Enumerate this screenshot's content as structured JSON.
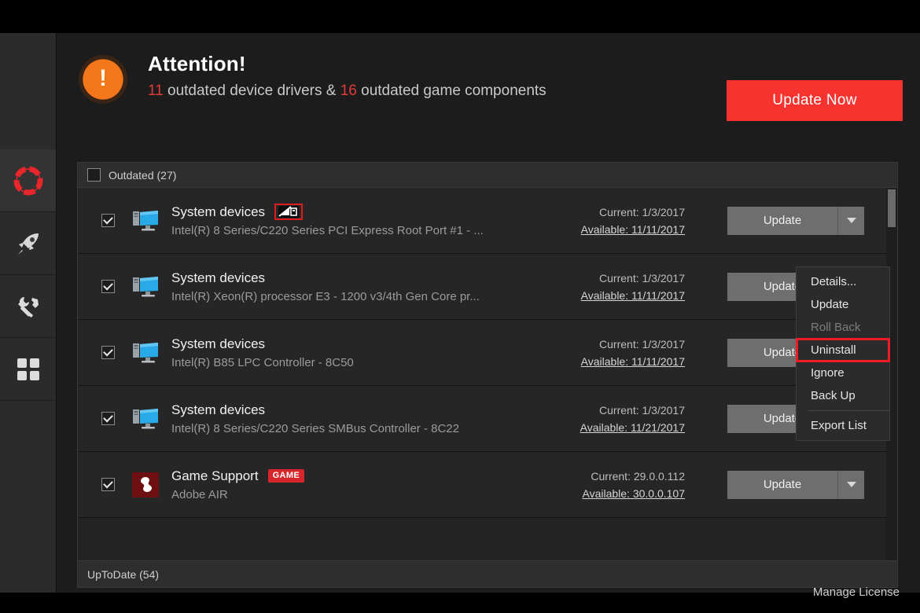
{
  "sidebar": {
    "items": [
      {
        "name": "life-ring-icon",
        "label": "Driver Updates",
        "active": true
      },
      {
        "name": "rocket-icon",
        "label": "Game Boost",
        "active": false
      },
      {
        "name": "tools-icon",
        "label": "Tools",
        "active": false
      },
      {
        "name": "grid-icon",
        "label": "Apps",
        "active": false
      }
    ]
  },
  "header": {
    "icon": "exclamation-icon",
    "title": "Attention!",
    "drivers_count": "11",
    "drivers_text": " outdated device drivers & ",
    "components_count": "16",
    "components_text": " outdated game components",
    "update_now_label": "Update Now"
  },
  "list": {
    "group_outdated_label": "Outdated (27)",
    "group_uptodate_label": "UpToDate (54)",
    "rows": [
      {
        "icon": "computer-icon",
        "checked": true,
        "title": "System devices",
        "badge": "no-signal-icon",
        "badge_highlighted": true,
        "subtitle": "Intel(R) 8 Series/C220 Series PCI Express Root Port #1 - ...",
        "current": "Current: 1/3/2017",
        "available": "Available: 11/11/2017",
        "button_label": "Update"
      },
      {
        "icon": "computer-icon",
        "checked": true,
        "title": "System devices",
        "badge": null,
        "subtitle": "Intel(R) Xeon(R) processor E3 - 1200 v3/4th Gen Core pr...",
        "current": "Current: 1/3/2017",
        "available": "Available: 11/11/2017",
        "button_label": "Update"
      },
      {
        "icon": "computer-icon",
        "checked": true,
        "title": "System devices",
        "badge": null,
        "subtitle": "Intel(R) B85 LPC Controller - 8C50",
        "current": "Current: 1/3/2017",
        "available": "Available: 11/11/2017",
        "button_label": "Update"
      },
      {
        "icon": "computer-icon",
        "checked": true,
        "title": "System devices",
        "badge": null,
        "subtitle": "Intel(R) 8 Series/C220 Series SMBus Controller - 8C22",
        "current": "Current: 1/3/2017",
        "available": "Available: 11/21/2017",
        "button_label": "Update"
      },
      {
        "icon": "adobe-air-icon",
        "checked": true,
        "title": "Game Support",
        "badge": "GAME",
        "subtitle": "Adobe AIR",
        "current": "Current: 29.0.0.112",
        "available": "Available: 30.0.0.107",
        "button_label": "Update"
      }
    ]
  },
  "menu": {
    "items": [
      {
        "label": "Details...",
        "disabled": false,
        "highlighted": false,
        "separator_after": false
      },
      {
        "label": "Update",
        "disabled": false,
        "highlighted": false,
        "separator_after": false
      },
      {
        "label": "Roll Back",
        "disabled": true,
        "highlighted": false,
        "separator_after": false
      },
      {
        "label": "Uninstall",
        "disabled": false,
        "highlighted": true,
        "separator_after": false
      },
      {
        "label": "Ignore",
        "disabled": false,
        "highlighted": false,
        "separator_after": false
      },
      {
        "label": "Back Up",
        "disabled": false,
        "highlighted": false,
        "separator_after": true
      },
      {
        "label": "Export List",
        "disabled": false,
        "highlighted": false,
        "separator_after": false
      }
    ]
  },
  "footer": {
    "manage_license_label": "Manage License"
  },
  "colors": {
    "accent_red": "#f7332f",
    "highlight_red": "#ee1c25",
    "warning_orange": "#f4761b",
    "panel_bg": "#232323",
    "row_bg": "#262626"
  }
}
